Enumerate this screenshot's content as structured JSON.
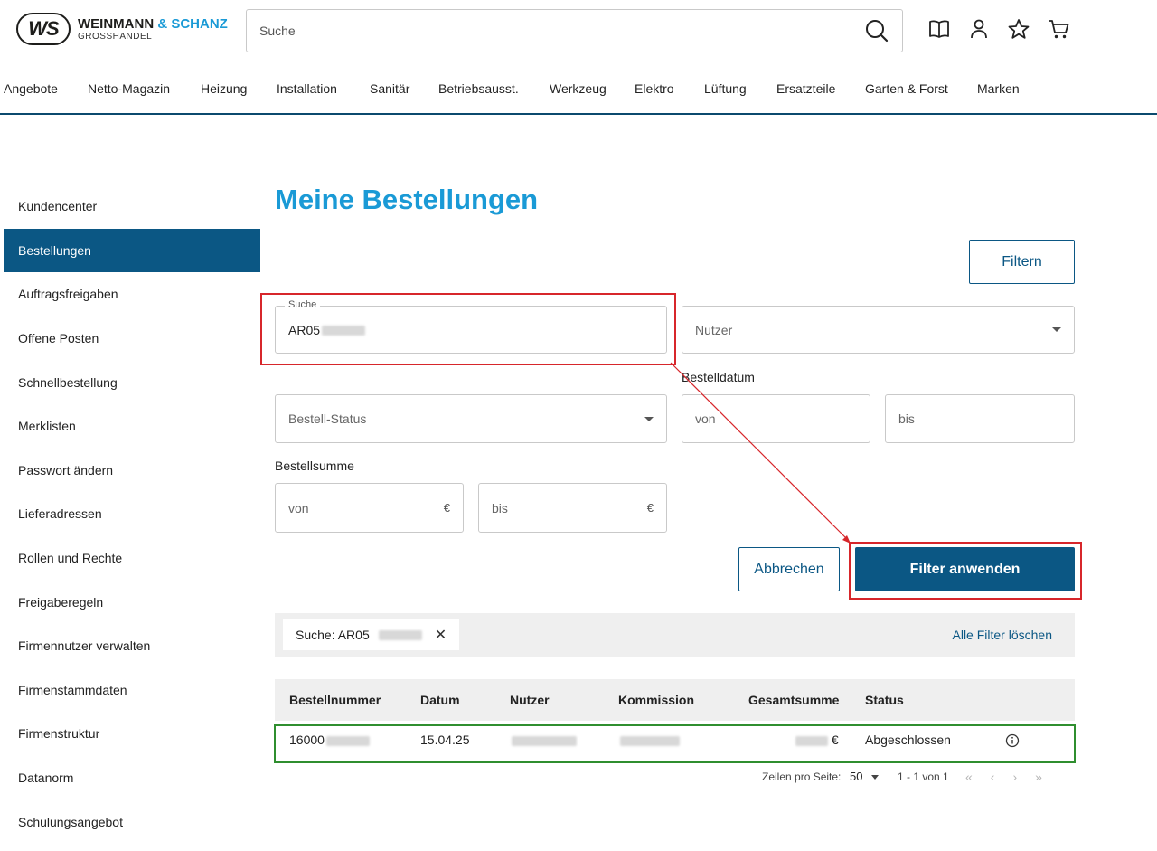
{
  "header": {
    "logo_mark": "WS",
    "logo_name_1": "WEINMANN",
    "logo_name_2": "& SCHANZ",
    "logo_sub": "GROSSHANDEL",
    "search_placeholder": "Suche"
  },
  "nav": [
    "Angebote",
    "Netto-Magazin",
    "Heizung",
    "Installation",
    "Sanitär",
    "Betriebsausst.",
    "Werkzeug",
    "Elektro",
    "Lüftung",
    "Ersatzteile",
    "Garten & Forst",
    "Marken"
  ],
  "sidebar": [
    {
      "label": "Kundencenter",
      "active": false
    },
    {
      "label": "Bestellungen",
      "active": true
    },
    {
      "label": "Auftragsfreigaben",
      "active": false
    },
    {
      "label": "Offene Posten",
      "active": false
    },
    {
      "label": "Schnellbestellung",
      "active": false
    },
    {
      "label": "Merklisten",
      "active": false
    },
    {
      "label": "Passwort ändern",
      "active": false
    },
    {
      "label": "Lieferadressen",
      "active": false
    },
    {
      "label": "Rollen und Rechte",
      "active": false
    },
    {
      "label": "Freigaberegeln",
      "active": false
    },
    {
      "label": "Firmennutzer verwalten",
      "active": false
    },
    {
      "label": "Firmenstammdaten",
      "active": false
    },
    {
      "label": "Firmenstruktur",
      "active": false
    },
    {
      "label": "Datanorm",
      "active": false
    },
    {
      "label": "Schulungsangebot",
      "active": false
    }
  ],
  "main": {
    "title": "Meine Bestellungen",
    "filter_button": "Filtern",
    "search_label": "Suche",
    "search_value": "AR05",
    "user_placeholder": "Nutzer",
    "order_date_label": "Bestelldatum",
    "status_placeholder": "Bestell-Status",
    "date_from": "von",
    "date_to": "bis",
    "sum_label": "Bestellsumme",
    "sum_from": "von",
    "sum_to": "bis",
    "currency": "€",
    "cancel_button": "Abbrechen",
    "apply_button": "Filter anwenden",
    "chip_label": "Suche: AR05",
    "clear_all": "Alle Filter löschen"
  },
  "table": {
    "columns": [
      "Bestellnummer",
      "Datum",
      "Nutzer",
      "Kommission",
      "Gesamtsumme",
      "Status"
    ],
    "rows": [
      {
        "order": "16000",
        "date": "15.04.25",
        "user": "",
        "commission": "",
        "total_suffix": "€",
        "status": "Abgeschlossen"
      }
    ]
  },
  "pager": {
    "rows_label": "Zeilen pro Seite:",
    "rows_value": "50",
    "range": "1 - 1 von 1",
    "arrows": [
      "«",
      "‹",
      "›",
      "»"
    ]
  }
}
